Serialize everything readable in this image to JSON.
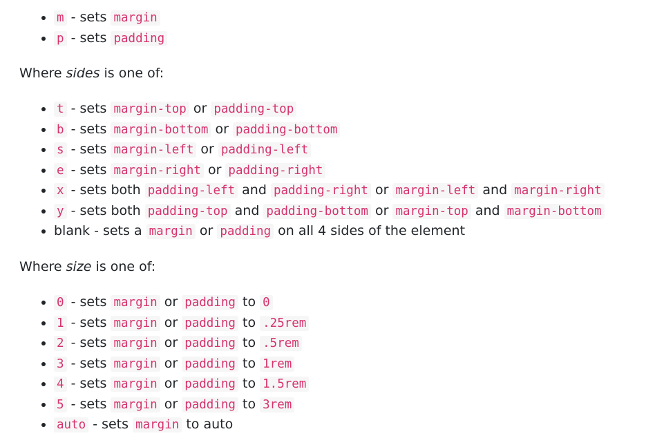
{
  "property_list": [
    {
      "key": "m",
      "desc": " - sets ",
      "value": "margin"
    },
    {
      "key": "p",
      "desc": " - sets ",
      "value": "padding"
    }
  ],
  "sides_heading": {
    "before": "Where ",
    "term": "sides",
    "after": " is one of:"
  },
  "sides_list": [
    {
      "key": "t",
      "a": "margin-top",
      "b": "padding-top"
    },
    {
      "key": "b",
      "a": "margin-bottom",
      "b": "padding-bottom"
    },
    {
      "key": "s",
      "a": "margin-left",
      "b": "padding-left"
    },
    {
      "key": "e",
      "a": "margin-right",
      "b": "padding-right"
    }
  ],
  "sides_x": {
    "key": "x",
    "c1": "padding-left",
    "c2": "padding-right",
    "c3": "margin-left",
    "c4": "margin-right"
  },
  "sides_y": {
    "key": "y",
    "c1": "padding-top",
    "c2": "padding-bottom",
    "c3": "margin-top",
    "c4": "margin-bottom"
  },
  "sides_blank": {
    "lead": "blank - sets a ",
    "c1": "margin",
    "mid": " or ",
    "c2": "padding",
    "tail": " on all 4 sides of the element"
  },
  "text": {
    "sets": " - sets ",
    "sets_both": " - sets both ",
    "or": " or ",
    "and": " and ",
    "to": " to "
  },
  "size_heading": {
    "before": "Where ",
    "term": "size",
    "after": " is one of:"
  },
  "size_list": [
    {
      "key": "0",
      "a": "margin",
      "b": "padding",
      "to": "0"
    },
    {
      "key": "1",
      "a": "margin",
      "b": "padding",
      "to": ".25rem"
    },
    {
      "key": "2",
      "a": "margin",
      "b": "padding",
      "to": ".5rem"
    },
    {
      "key": "3",
      "a": "margin",
      "b": "padding",
      "to": "1rem"
    },
    {
      "key": "4",
      "a": "margin",
      "b": "padding",
      "to": "1.5rem"
    },
    {
      "key": "5",
      "a": "margin",
      "b": "padding",
      "to": "3rem"
    }
  ],
  "size_auto": {
    "key": "auto",
    "desc": " - sets ",
    "value": "margin",
    "tail": " to auto"
  }
}
